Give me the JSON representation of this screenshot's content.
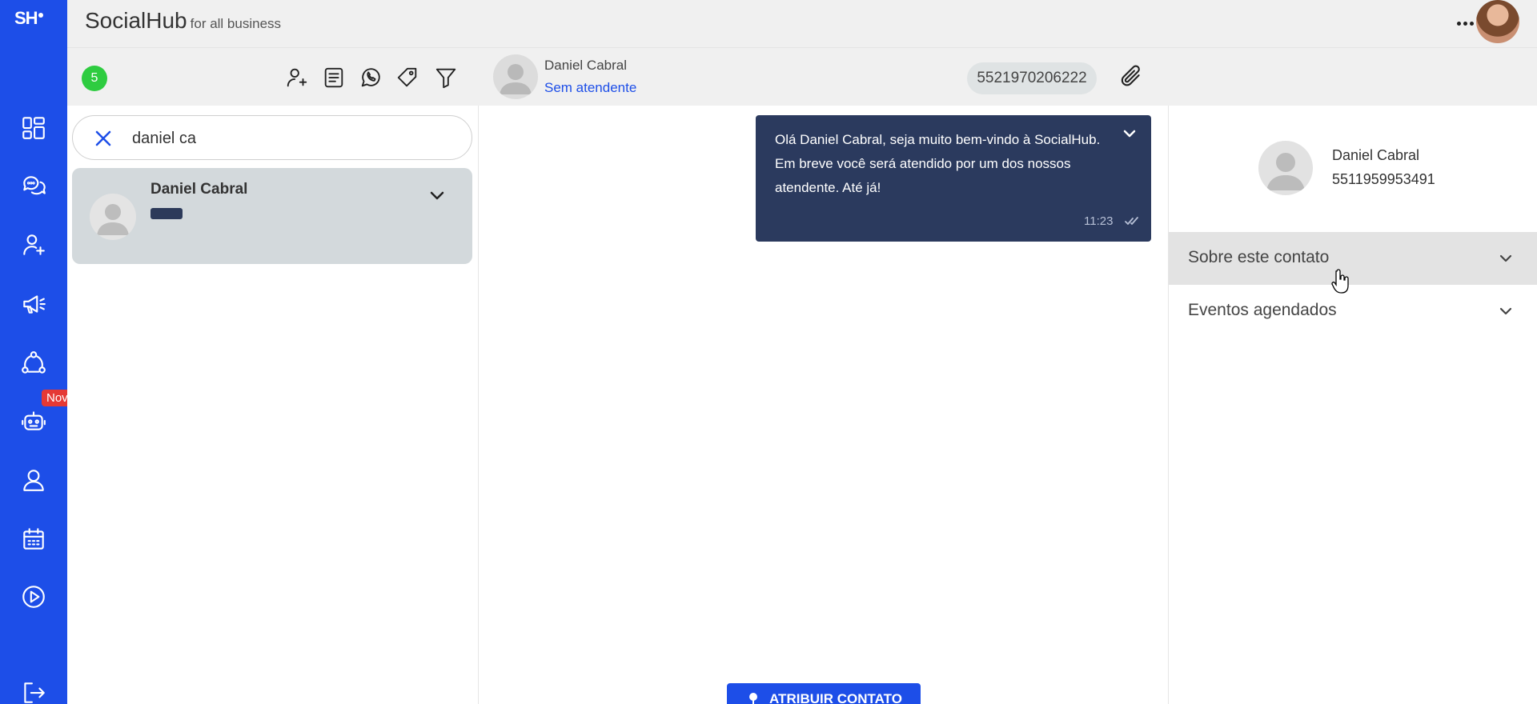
{
  "app": {
    "logo": "SH",
    "title": "SocialHub",
    "subtitle": "for all business"
  },
  "sidebar": {
    "items": [
      {
        "icon": "dashboard-icon"
      },
      {
        "icon": "chat-icon"
      },
      {
        "icon": "add-contact-icon"
      },
      {
        "icon": "megaphone-icon"
      },
      {
        "icon": "network-icon"
      },
      {
        "icon": "bot-icon",
        "badge": "Novo"
      },
      {
        "icon": "user-icon"
      },
      {
        "icon": "calendar-icon"
      },
      {
        "icon": "play-icon"
      },
      {
        "icon": "logout-icon"
      }
    ]
  },
  "list": {
    "count": "5",
    "tools": [
      "add-contact-icon",
      "notes-icon",
      "whatsapp-icon",
      "tag-icon",
      "filter-icon"
    ],
    "search": {
      "value": "daniel ca",
      "placeholder": ""
    },
    "contacts": [
      {
        "name": "Daniel Cabral",
        "tag_color": "#2c3a5a"
      }
    ]
  },
  "chat": {
    "contact_name": "Daniel Cabral",
    "status": "Sem atendente",
    "phone": "5521970206222",
    "messages": [
      {
        "text": "Olá Daniel Cabral, seja muito bem-vindo à SocialHub. Em breve você será atendido por um dos nossos atendente. Até já!",
        "time": "11:23"
      }
    ],
    "assign_label": "ATRIBUIR CONTATO"
  },
  "details": {
    "name": "Daniel Cabral",
    "phone": "5511959953491",
    "sections": [
      {
        "label": "Sobre este contato",
        "active": true
      },
      {
        "label": "Eventos agendados",
        "active": false
      }
    ]
  },
  "colors": {
    "sidebar": "#1d4ee8",
    "accent": "#1d4ee8",
    "message_bg": "#2b3a5e",
    "online": "#2ecc40",
    "badge": "#e53935"
  }
}
